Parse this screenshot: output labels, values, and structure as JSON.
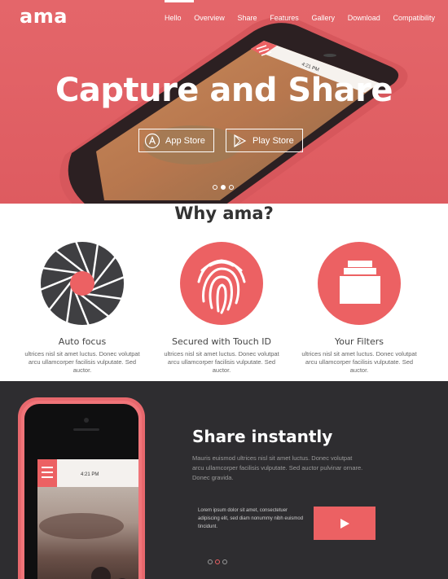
{
  "brand": {
    "logo": "ama"
  },
  "nav": {
    "items": [
      "Hello",
      "Overview",
      "Share",
      "Features",
      "Gallery",
      "Download",
      "Compatibility"
    ],
    "active_index": 0
  },
  "hero": {
    "title": "Capture and Share",
    "phone_time": "4:21 PM",
    "app_store_label": "App Store",
    "play_store_label": "Play Store",
    "slide_dots": 3,
    "active_slide": 1
  },
  "why": {
    "title": "Why ama?",
    "features": [
      {
        "icon": "aperture-icon",
        "title": "Auto focus",
        "text": "ultrices nisl sit amet luctus. Donec volutpat arcu ullamcorper facilisis vulputate. Sed auctor."
      },
      {
        "icon": "fingerprint-icon",
        "title": "Secured with Touch ID",
        "text": "ultrices nisl sit amet luctus. Donec volutpat arcu ullamcorper facilisis vulputate. Sed auctor."
      },
      {
        "icon": "filters-stack-icon",
        "title": "Your Filters",
        "text": "ultrices nisl sit amet luctus. Donec volutpat arcu ullamcorper facilisis vulputate. Sed auctor."
      }
    ]
  },
  "share": {
    "title": "Share instantly",
    "description": "Mauris euismod ultrices nisl sit amet luctus. Donec volutpat arcu ullamcorper facilisis vulputate. Sed auctor pulvinar ornare. Donec gravida.",
    "small_text": "Lorem ipsum dolor sit amet, consectetuer adipiscing elit, sed diam nonummy nibh euismod tincidunt.",
    "phone_time": "4:21 PM",
    "slide_dots": 3,
    "active_slide": 1
  },
  "colors": {
    "accent": "#ec6163",
    "hero_bg": "#e4666a",
    "dark_bg": "#2e2d30",
    "icon_dark": "#3f3f42"
  }
}
